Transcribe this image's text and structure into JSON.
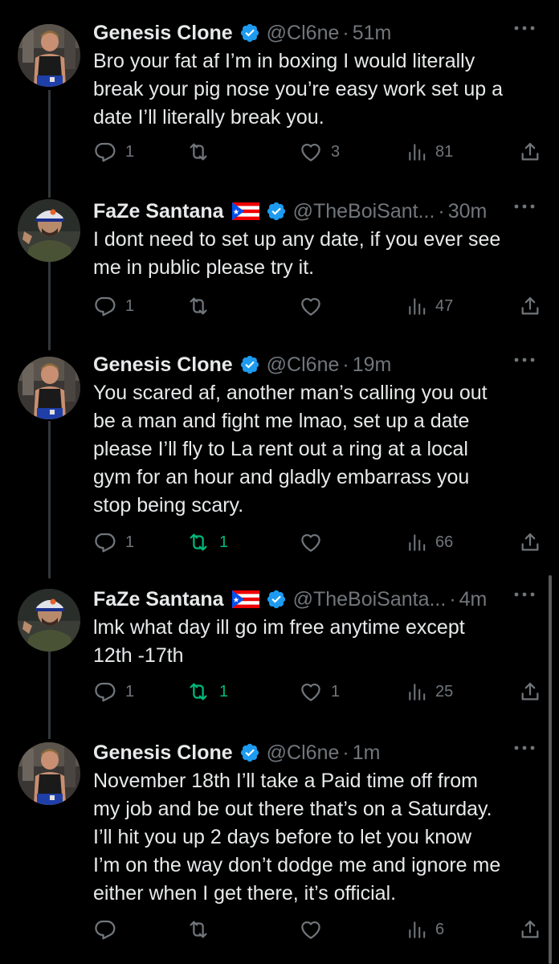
{
  "tweets": [
    {
      "author": "genesis",
      "name": "Genesis Clone",
      "handle": "@Cl6ne",
      "time": "51m",
      "has_flag": false,
      "text": "Bro your fat af I’m in boxing I would literally\nbreak your pig nose you’re easy work set up a\ndate I’ll literally break you.",
      "replies": "1",
      "reposts": "",
      "likes": "3",
      "views": "81",
      "reposted": false
    },
    {
      "author": "faze",
      "name": "FaZe Santana",
      "handle": "@TheBoiSant...",
      "time": "30m",
      "has_flag": true,
      "text": "I dont need to set up any date, if you ever see\nme in public please try it.",
      "replies": "1",
      "reposts": "",
      "likes": "",
      "views": "47",
      "reposted": false
    },
    {
      "author": "genesis",
      "name": "Genesis Clone",
      "handle": "@Cl6ne",
      "time": "19m",
      "has_flag": false,
      "text": "You scared af, another man’s calling you out\nbe a man and fight me lmao, set up a date\nplease I’ll fly to La rent out a ring at a local\ngym for an hour and gladly embarrass you\nstop being scary.",
      "replies": "1",
      "reposts": "1",
      "likes": "",
      "views": "66",
      "reposted": true
    },
    {
      "author": "faze",
      "name": "FaZe Santana",
      "handle": "@TheBoiSanta...",
      "time": "4m",
      "has_flag": true,
      "text": "lmk what day ill go im free anytime except\n12th -17th",
      "replies": "1",
      "reposts": "1",
      "likes": "1",
      "views": "25",
      "reposted": true
    },
    {
      "author": "genesis",
      "name": "Genesis Clone",
      "handle": "@Cl6ne",
      "time": "1m",
      "has_flag": false,
      "text": "November 18th I’ll take a Paid time off from\nmy job and be out there that’s on a Saturday.\nI’ll hit you up 2 days before to let you know\nI’m on the way don’t dodge me and ignore me\neither when I get there, it’s official.",
      "replies": "",
      "reposts": "",
      "likes": "",
      "views": "6",
      "reposted": false
    }
  ],
  "dot_separator": "·",
  "colors": {
    "background": "#000000",
    "text": "#e7e9ea",
    "muted": "#71767b",
    "verified": "#1d9bf0",
    "repost_active": "#00ba7c",
    "thread_line": "#333639"
  }
}
